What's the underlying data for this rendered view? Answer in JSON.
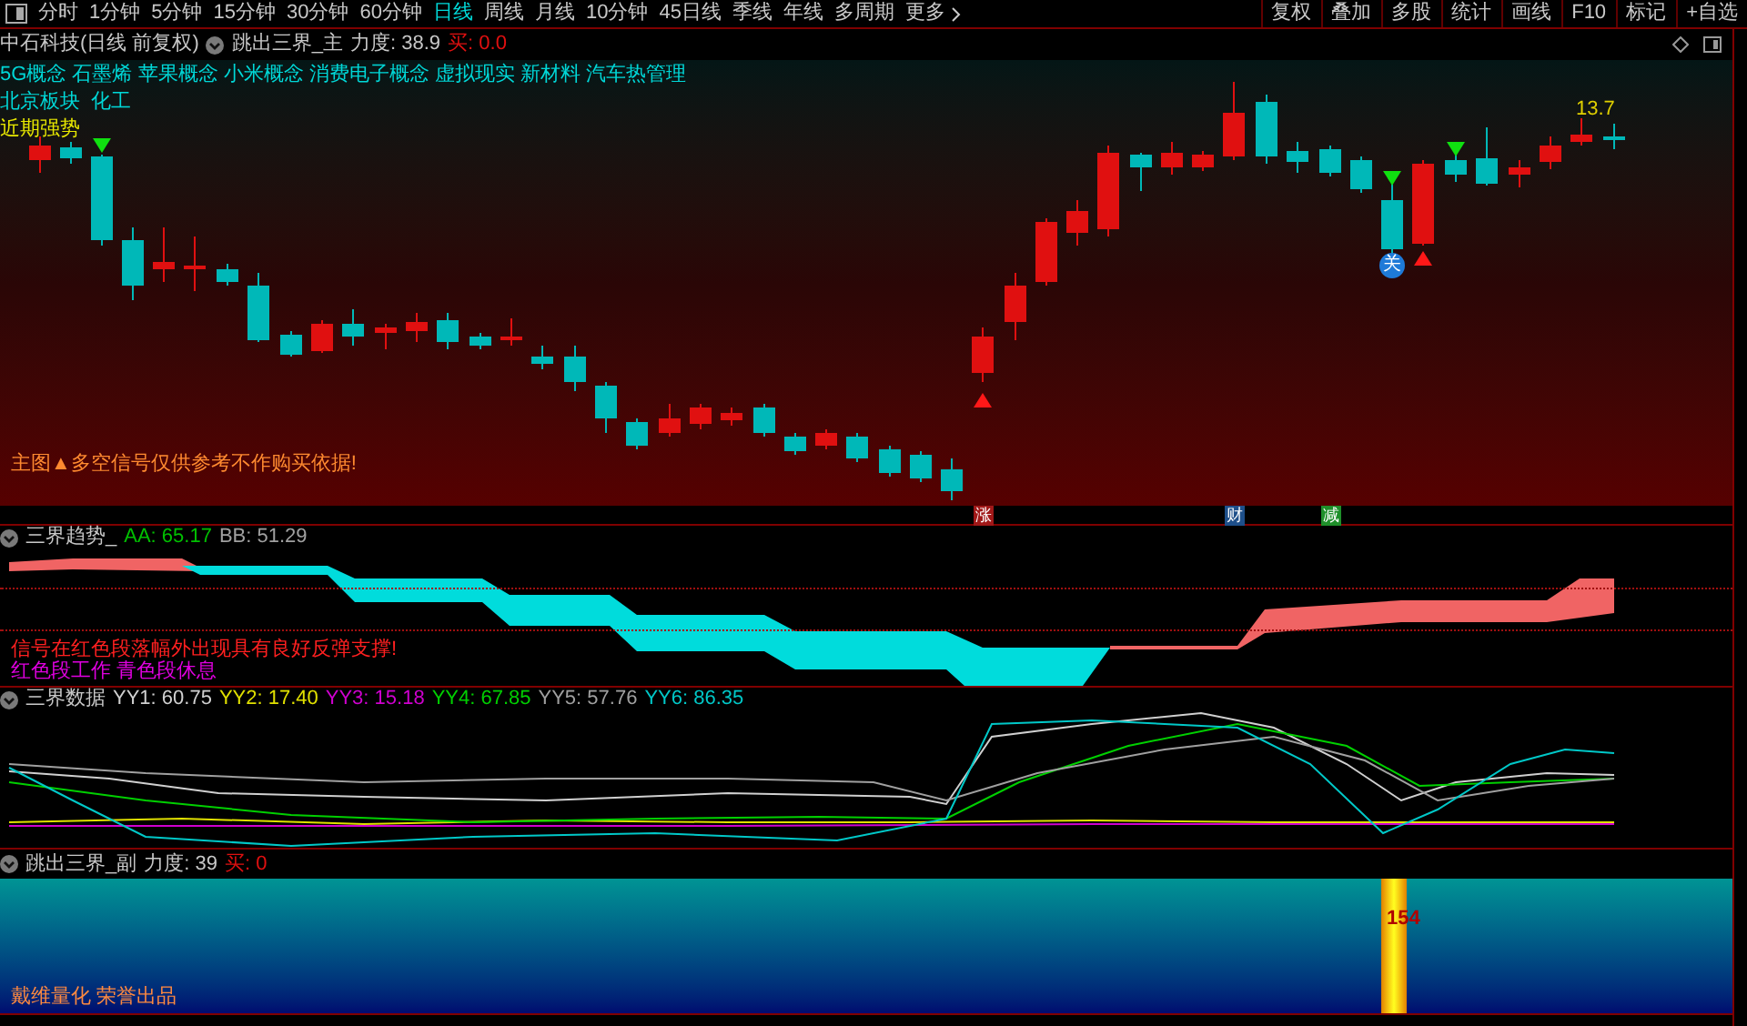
{
  "toolbar": {
    "periods": [
      {
        "label": "分时",
        "selected": false
      },
      {
        "label": "1分钟",
        "selected": false
      },
      {
        "label": "5分钟",
        "selected": false
      },
      {
        "label": "15分钟",
        "selected": false
      },
      {
        "label": "30分钟",
        "selected": false
      },
      {
        "label": "60分钟",
        "selected": false
      },
      {
        "label": "日线",
        "selected": true
      },
      {
        "label": "周线",
        "selected": false
      },
      {
        "label": "月线",
        "selected": false
      },
      {
        "label": "10分钟",
        "selected": false
      },
      {
        "label": "45日线",
        "selected": false
      },
      {
        "label": "季线",
        "selected": false
      },
      {
        "label": "年线",
        "selected": false
      },
      {
        "label": "多周期",
        "selected": false
      }
    ],
    "more": "更多",
    "buttons": [
      "复权",
      "叠加",
      "多股",
      "统计",
      "画线",
      "F10",
      "标记",
      "+自选"
    ]
  },
  "main_panel": {
    "security": "中石科技(日线 前复权)",
    "indicator": "跳出三界_主",
    "strength": "力度: 38.9",
    "buy": "买: 0.0",
    "concept_tags": "5G概念 石墨烯 苹果概念 小米概念 消费电子概念 虚拟现实 新材料 汽车热管理",
    "sector_tags": "北京板块  化工",
    "trend_tag": "近期强势",
    "price_label": "13.7",
    "signal_badge": "关",
    "disclaimer": "主图▲多空信号仅供参考不作购买依据!"
  },
  "event_markers": [
    {
      "label": "涨",
      "color": "#a01818"
    },
    {
      "label": "财",
      "color": "#1e4f8a"
    },
    {
      "label": "减",
      "color": "#1f8f2a"
    }
  ],
  "trend_panel": {
    "title": "三界趋势_",
    "readings": [
      {
        "label": "AA: 65.17",
        "color": "#00c000"
      },
      {
        "label": "BB: 51.29",
        "color": "#a0a0a0"
      }
    ],
    "note_1": "信号在红色段落幅外出现具有良好反弹支撑!",
    "note_2": "红色段工作 青色段休息"
  },
  "data_panel": {
    "title": "三界数据",
    "readings": [
      {
        "label": "YY1: 60.75",
        "color": "#d0d0d0"
      },
      {
        "label": "YY2: 17.40",
        "color": "#e0e000"
      },
      {
        "label": "YY3: 15.18",
        "color": "#d000d0"
      },
      {
        "label": "YY4: 67.85",
        "color": "#00d000"
      },
      {
        "label": "YY5: 57.76",
        "color": "#a0a0a0"
      },
      {
        "label": "YY6: 86.35",
        "color": "#00c8c8"
      }
    ]
  },
  "sub_panel": {
    "indicator": "跳出三界_副",
    "strength": "力度: 39",
    "buy": "买: 0",
    "bar_value": "154",
    "credit": "戴维量化 荣誉出品"
  }
}
